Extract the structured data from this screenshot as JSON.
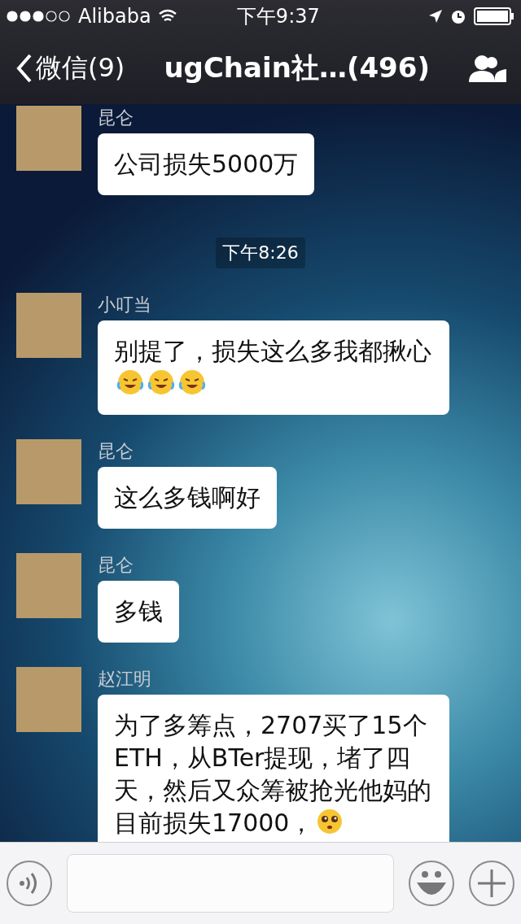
{
  "status_bar": {
    "carrier": "Alibaba",
    "time": "下午9:37"
  },
  "nav": {
    "back_label": "微信(9)",
    "title": "ugChain社…(496)"
  },
  "messages": [
    {
      "kind": "message",
      "sender": "昆仑",
      "text": "公司损失5000万"
    },
    {
      "kind": "time",
      "text": "下午8:26"
    },
    {
      "kind": "message",
      "sender": "小叮当",
      "text": "别提了，损失这么多我都揪心",
      "emojis": [
        {
          "kind": "tears-of-joy"
        },
        {
          "kind": "tears-of-joy"
        },
        {
          "kind": "tears-of-joy"
        }
      ]
    },
    {
      "kind": "message",
      "sender": "昆仑",
      "text": "这么多钱啊好"
    },
    {
      "kind": "message",
      "sender": "昆仑",
      "text": "多钱"
    },
    {
      "kind": "message",
      "sender": "赵江明",
      "text": "为了多筹点，2707买了15个ETH，从BTer提现，堵了四天，然后又众筹被抢光他妈的目前损失17000，",
      "emojis": [
        {
          "kind": "pleading"
        }
      ]
    }
  ]
}
